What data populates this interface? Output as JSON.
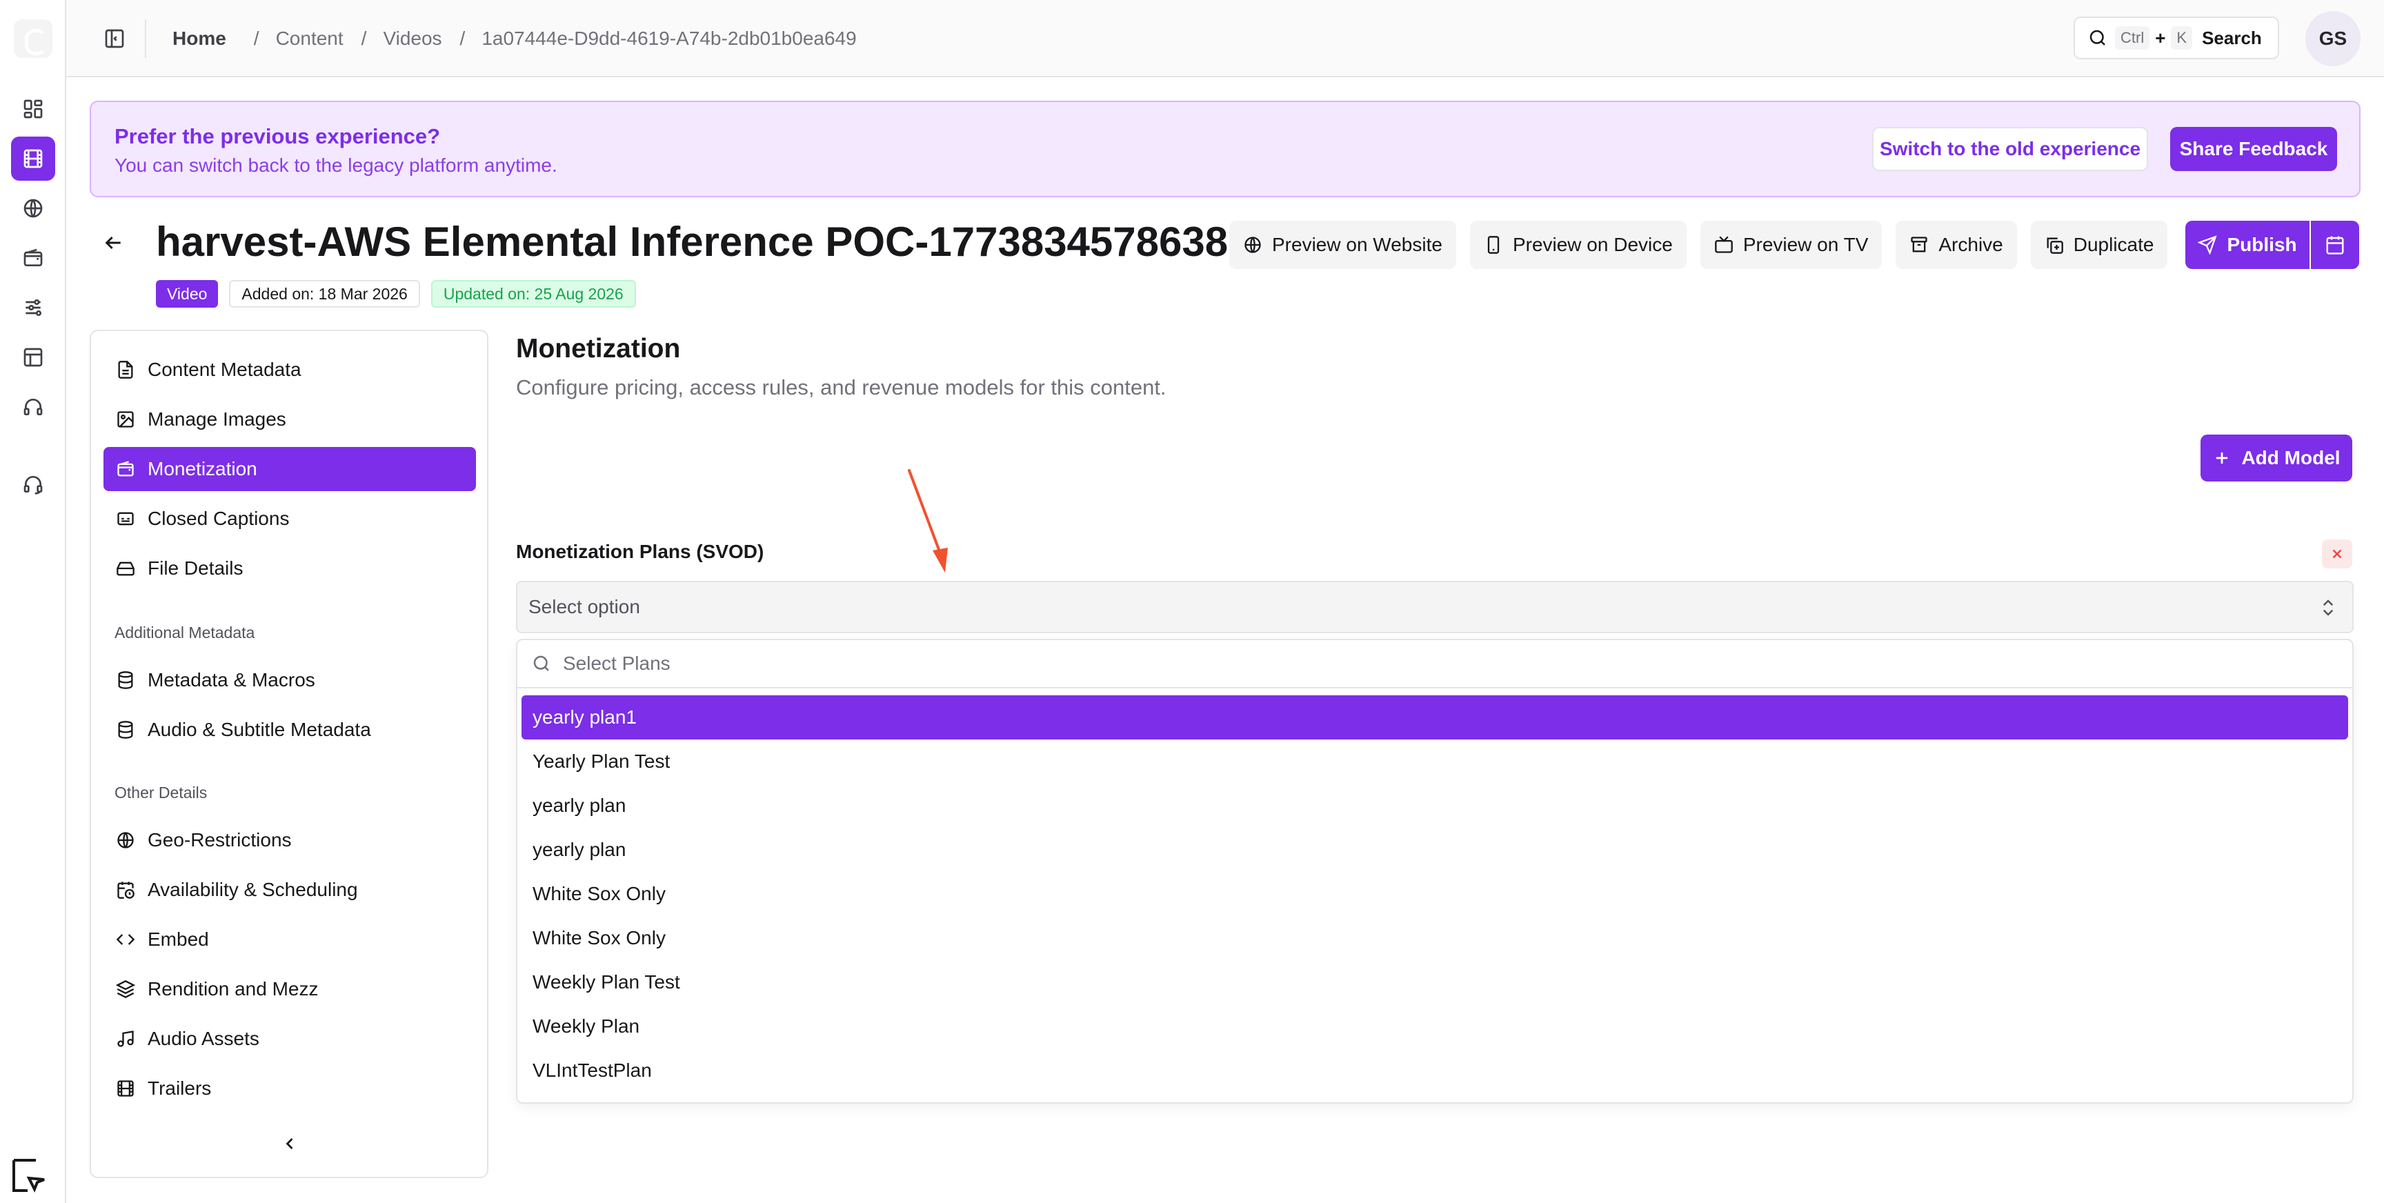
{
  "topbar": {
    "breadcrumb": {
      "home": "Home",
      "items": [
        "Content",
        "Videos",
        "1a07444e-D9dd-4619-A74b-2db01b0ea649"
      ],
      "separator": "/"
    },
    "search": {
      "kbd_ctrl": "Ctrl",
      "plus": "+",
      "kbd_k": "K",
      "label": "Search"
    },
    "avatar_initials": "GS"
  },
  "banner": {
    "title": "Prefer the previous experience?",
    "subtitle": "You can switch back to the legacy platform anytime.",
    "switch_label": "Switch to the old experience",
    "feedback_label": "Share Feedback"
  },
  "header": {
    "title": "harvest-AWS Elemental Inference POC-1773834578638",
    "badges": {
      "type": "Video",
      "added": "Added on: 18 Mar 2026",
      "updated": "Updated on: 25 Aug 2026"
    },
    "actions": {
      "preview_website": "Preview on Website",
      "preview_device": "Preview on Device",
      "preview_tv": "Preview on TV",
      "archive": "Archive",
      "duplicate": "Duplicate",
      "publish": "Publish"
    }
  },
  "nav": {
    "items": [
      "Content Metadata",
      "Manage Images",
      "Monetization",
      "Closed Captions",
      "File Details"
    ],
    "additional_heading": "Additional Metadata",
    "additional": [
      "Metadata & Macros",
      "Audio & Subtitle Metadata"
    ],
    "other_heading": "Other Details",
    "other": [
      "Geo-Restrictions",
      "Availability & Scheduling",
      "Embed",
      "Rendition and Mezz",
      "Audio Assets",
      "Trailers"
    ]
  },
  "main": {
    "title": "Monetization",
    "subtitle": "Configure pricing, access rules, and revenue models for this content.",
    "add_model_label": "Add Model",
    "field_label": "Monetization Plans (SVOD)",
    "select_placeholder": "Select option",
    "dropdown": {
      "search_placeholder": "Select Plans",
      "options": [
        "yearly plan1",
        "Yearly Plan Test",
        "yearly plan",
        "yearly plan",
        "White Sox Only",
        "White Sox Only",
        "Weekly Plan Test",
        "Weekly Plan",
        "VLIntTestPlan"
      ]
    }
  },
  "colors": {
    "accent": "#7c2ee8",
    "banner_bg": "#f3e8ff",
    "success": "#16a34a",
    "danger": "#ef4444",
    "annotation_arrow": "#f0522e"
  }
}
